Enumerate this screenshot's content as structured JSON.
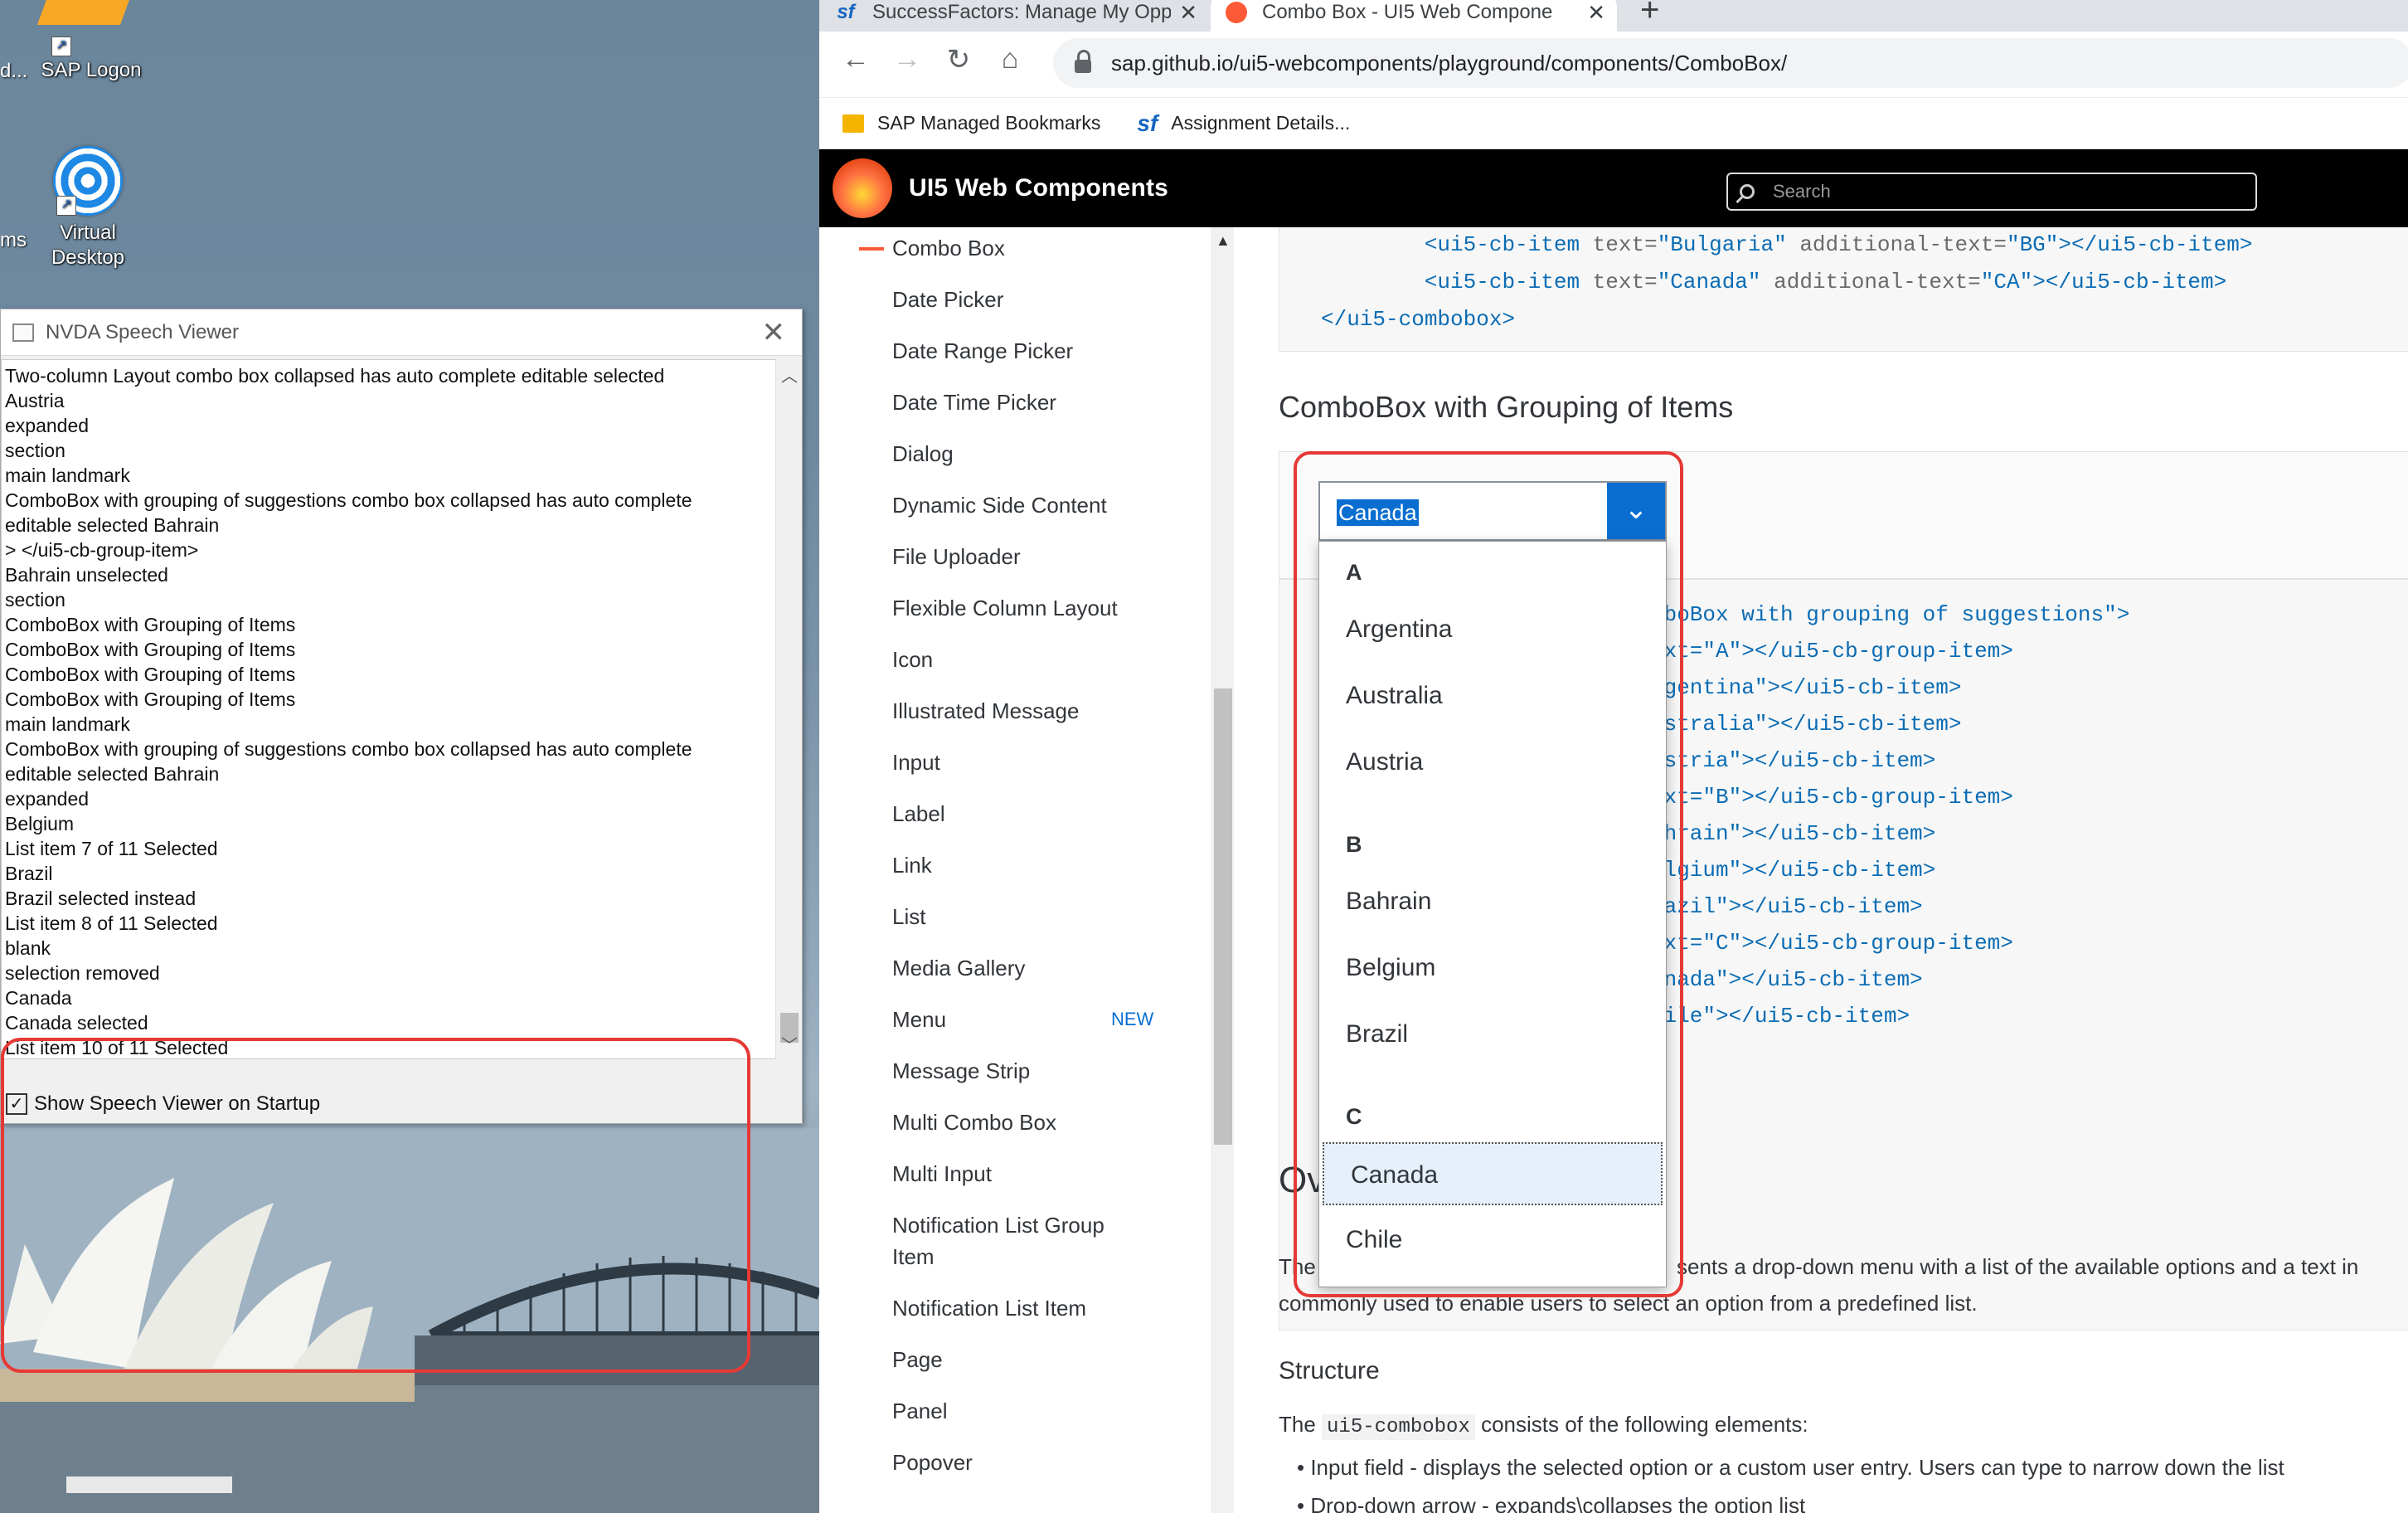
{
  "desktop": {
    "icons": [
      {
        "label": "SAP Logon"
      },
      {
        "label": "Virtual Desktop"
      }
    ],
    "edge_labels": [
      "d...",
      "ms"
    ]
  },
  "nvda": {
    "title": "NVDA Speech Viewer",
    "lines": [
      "Two-column Layout  combo box  collapsed  has auto complete  editable  selected",
      "Austria",
      "expanded",
      "section",
      "main landmark",
      "ComboBox with grouping of suggestions  combo box  collapsed  has auto complete",
      "editable  selected Bahrain",
      "> </ui5-cb-group-item>",
      "Bahrain unselected",
      "section",
      "ComboBox with Grouping of Items",
      "ComboBox with Grouping of Items",
      "ComboBox with Grouping of Items",
      "ComboBox with Grouping of Items",
      "main landmark",
      "ComboBox with grouping of suggestions  combo box  collapsed  has auto complete",
      "editable  selected Bahrain",
      "expanded",
      "Belgium",
      "List item 7 of 11 Selected",
      "Brazil",
      "Brazil selected instead",
      "List item 8 of 11 Selected",
      "blank",
      "selection removed",
      "Canada",
      "Canada selected",
      "List item 10 of 11 Selected"
    ],
    "checkbox_label": "Show Speech Viewer on Startup",
    "checkbox_checked": true
  },
  "browser": {
    "tabs": [
      {
        "label": "SuccessFactors: Manage My Opp",
        "favicon": "sf"
      },
      {
        "label": "Combo Box - UI5 Web Compone",
        "favicon": "ui5",
        "active": true
      }
    ],
    "new_tab": "+",
    "url": "sap.github.io/ui5-webcomponents/playground/components/ComboBox/",
    "bookmarks": [
      {
        "label": "SAP Managed Bookmarks",
        "icon": "folder-icon"
      },
      {
        "label": "Assignment Details...",
        "icon": "sf"
      }
    ]
  },
  "ui5": {
    "brand": "UI5 Web Components",
    "search_placeholder": "Search",
    "nav": [
      {
        "label": "Combo Box",
        "active": true
      },
      {
        "label": "Date Picker"
      },
      {
        "label": "Date Range Picker"
      },
      {
        "label": "Date Time Picker"
      },
      {
        "label": "Dialog"
      },
      {
        "label": "Dynamic Side Content"
      },
      {
        "label": "File Uploader"
      },
      {
        "label": "Flexible Column Layout"
      },
      {
        "label": "Icon"
      },
      {
        "label": "Illustrated Message"
      },
      {
        "label": "Input"
      },
      {
        "label": "Label"
      },
      {
        "label": "Link"
      },
      {
        "label": "List"
      },
      {
        "label": "Media Gallery"
      },
      {
        "label": "Menu",
        "badge": "NEW"
      },
      {
        "label": "Message Strip"
      },
      {
        "label": "Multi Combo Box"
      },
      {
        "label": "Multi Input"
      },
      {
        "label": "Notification List Group"
      },
      {
        "label": "Item"
      },
      {
        "label": "Notification List Item"
      },
      {
        "label": "Page"
      },
      {
        "label": "Panel"
      },
      {
        "label": "Popover"
      }
    ],
    "code_top": [
      {
        "indent": "        ",
        "tag_open": "<ui5-cb-item",
        "attr1": " text=",
        "val1": "\"Bulgaria\"",
        "attr2": " additional-text=",
        "val2": "\"BG\"",
        "tag_close": "></ui5-cb-item>"
      },
      {
        "indent": "        ",
        "tag_open": "<ui5-cb-item",
        "attr1": " text=",
        "val1": "\"Canada\"",
        "attr2": " additional-text=",
        "val2": "\"CA\"",
        "tag_close": "></ui5-cb-item>"
      },
      {
        "indent": "",
        "tag_open": "</ui5-combobox>",
        "attr1": "",
        "val1": "",
        "attr2": "",
        "val2": "",
        "tag_close": ""
      }
    ],
    "section_title": "ComboBox with Grouping of Items",
    "combobox": {
      "value": "Canada",
      "groups": [
        {
          "header": "A",
          "items": [
            "Argentina",
            "Australia",
            "Austria"
          ]
        },
        {
          "header": "B",
          "items": [
            "Bahrain",
            "Belgium",
            "Brazil"
          ]
        },
        {
          "header": "C",
          "items": [
            "Canada",
            "Chile"
          ]
        }
      ],
      "selected": "Canada"
    },
    "code_visible": [
      "mboBox with grouping of suggestions\">",
      "ext=\"A\"></ui5-cb-group-item>",
      "rgentina\"></ui5-cb-item>",
      "ustralia\"></ui5-cb-item>",
      "ustria\"></ui5-cb-item>",
      "ext=\"B\"></ui5-cb-group-item>",
      "ahrain\"></ui5-cb-item>",
      "elgium\"></ui5-cb-item>",
      "razil\"></ui5-cb-item>",
      "ext=\"C\"></ui5-cb-group-item>",
      "anada\"></ui5-cb-item>",
      "hile\"></ui5-cb-item>"
    ],
    "overview_heading_fragment": "Ov",
    "overview_p1_start": "The",
    "overview_p1_end": "sents a drop-down menu with a list of the available options and a text in",
    "overview_p2": "commonly used to enable users to select an option from a predefined list.",
    "structure_heading": "Structure",
    "structure_p_pre": "The ",
    "structure_p_code": "ui5-combobox",
    "structure_p_post": " consists of the following elements:",
    "bullets": [
      "Input field - displays the selected option or a custom user entry. Users can type to narrow down the list",
      "Drop-down arrow - expands\\collapses the option list"
    ]
  }
}
